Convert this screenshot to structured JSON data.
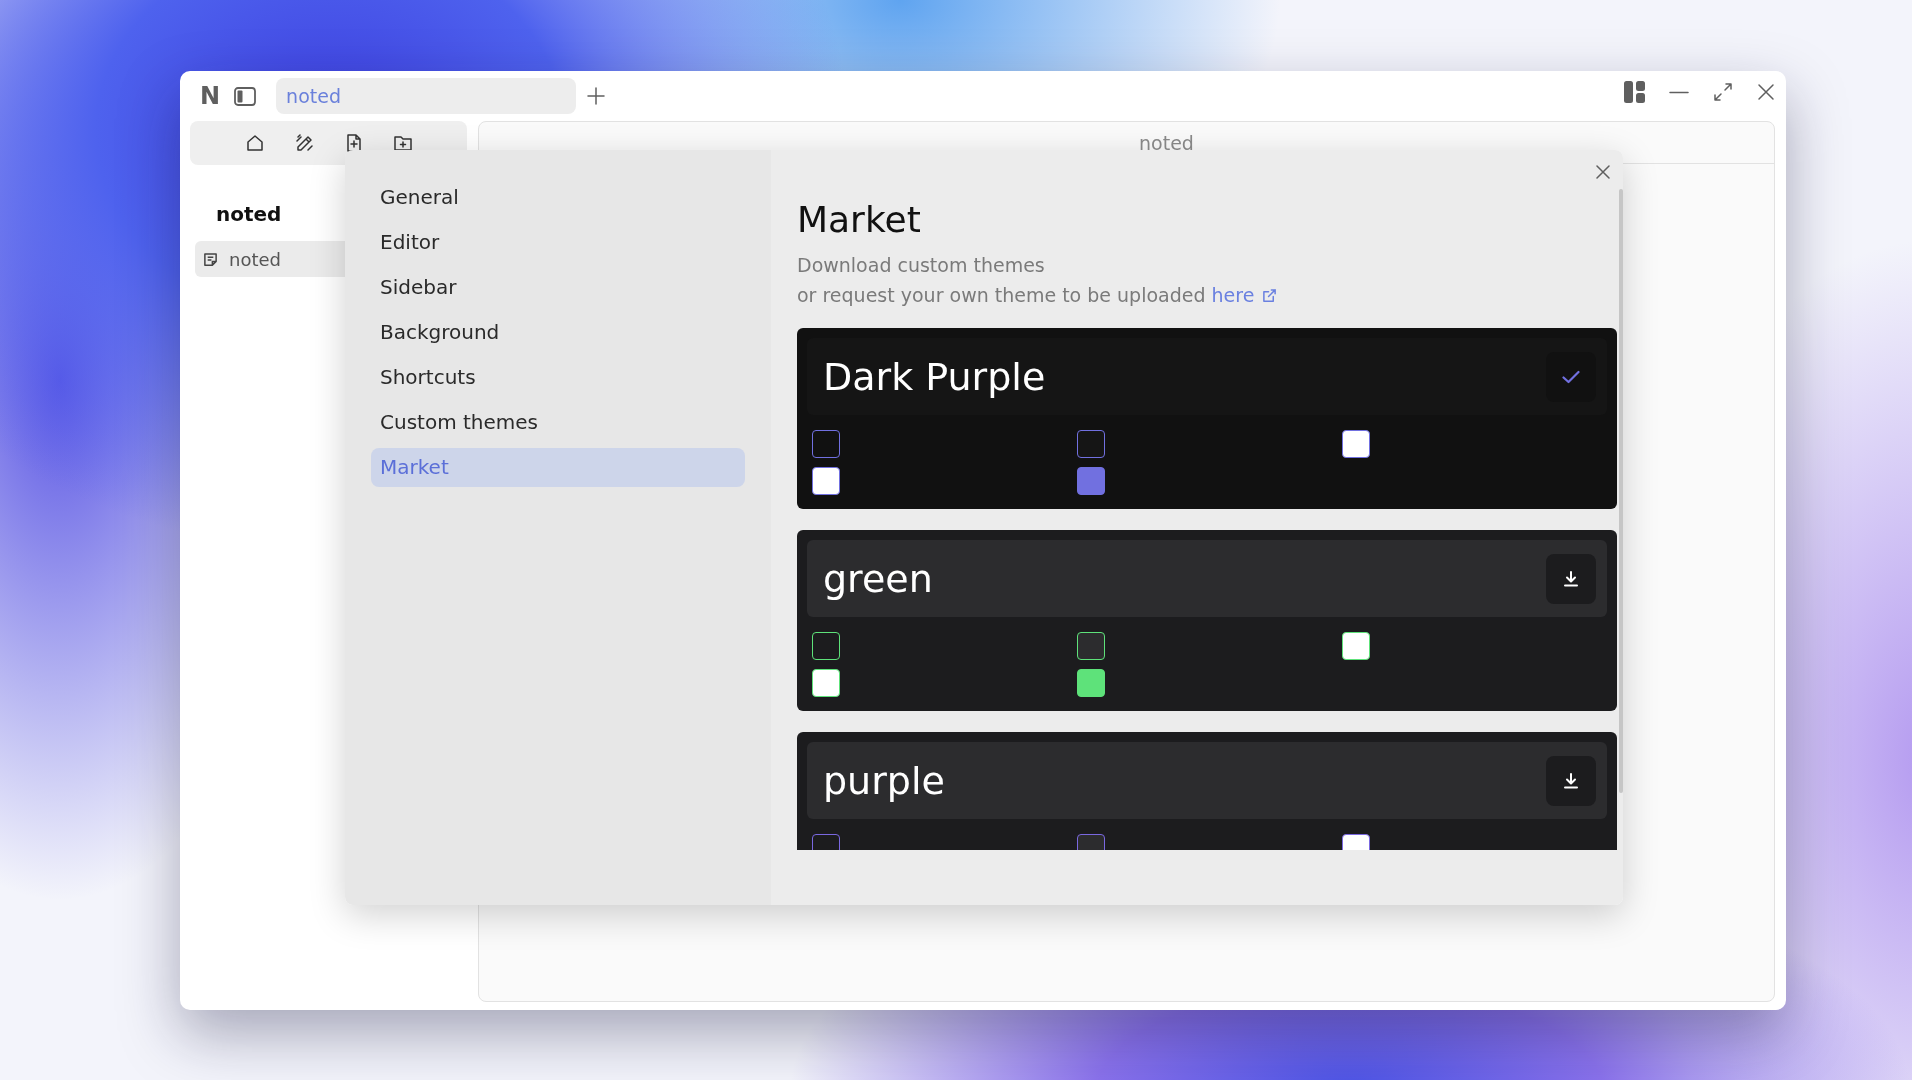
{
  "window": {
    "logo": "N",
    "tabs": [
      {
        "label": "noted",
        "selected": true
      }
    ]
  },
  "sidebar": {
    "title": "noted",
    "items": [
      {
        "label": "noted",
        "selected": true
      }
    ]
  },
  "editor": {
    "title": "noted"
  },
  "settings": {
    "nav": [
      {
        "label": "General",
        "selected": false
      },
      {
        "label": "Editor",
        "selected": false
      },
      {
        "label": "Sidebar",
        "selected": false
      },
      {
        "label": "Background",
        "selected": false
      },
      {
        "label": "Shortcuts",
        "selected": false
      },
      {
        "label": "Custom themes",
        "selected": false
      },
      {
        "label": "Market",
        "selected": true
      }
    ],
    "page": {
      "title": "Market",
      "description": "Download custom themes",
      "request": "or request your own theme to be uploaded",
      "link": "here",
      "themes": [
        {
          "name": "Dark Purple",
          "installed": true,
          "color": "#7170e0",
          "swatches": [
            {
              "color": "#111111"
            },
            {
              "color": "#151515"
            },
            {
              "color": "#ffffff"
            },
            {
              "color": "#ffffff"
            },
            {
              "color": "#7170e0"
            }
          ]
        },
        {
          "name": "green",
          "installed": false,
          "color": "#5ee27a",
          "swatches": [
            {
              "color": "#1c1c1e"
            },
            {
              "color": "#2c2c2e"
            },
            {
              "color": "#ffffff"
            },
            {
              "color": "#ffffff"
            },
            {
              "color": "#5ee27a"
            }
          ]
        },
        {
          "name": "purple",
          "installed": false,
          "color": "#7a68e0",
          "swatches": [
            {
              "color": "#1c1c1e"
            },
            {
              "color": "#2c2c2e"
            },
            {
              "color": "#ffffff"
            }
          ]
        }
      ]
    }
  }
}
